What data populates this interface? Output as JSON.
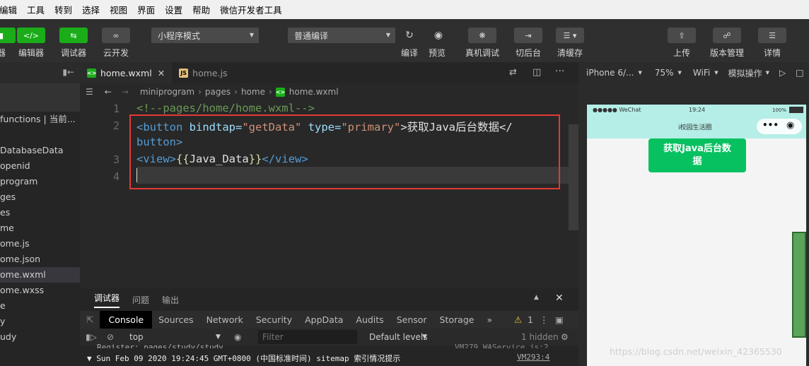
{
  "menu": [
    "编辑",
    "工具",
    "转到",
    "选择",
    "视图",
    "界面",
    "设置",
    "帮助",
    "微信开发者工具"
  ],
  "toolbar": {
    "left_partial": "器",
    "editor": "编辑器",
    "debugger": "调试器",
    "cloud": "云开发",
    "mode": "小程序模式",
    "compile_mode": "普通编译",
    "compile": "编译",
    "preview": "预览",
    "remote_debug": "真机调试",
    "background": "切后台",
    "clear_cache": "清缓存",
    "upload": "上传",
    "version": "版本管理",
    "details": "详情"
  },
  "sidebar": {
    "items": [
      "functions | 当前...",
      "",
      "DatabaseData",
      "openid",
      "program",
      "ges",
      "es",
      "me",
      "ome.js",
      "ome.json",
      "ome.wxml",
      "ome.wxss",
      "e",
      "y",
      "udy"
    ],
    "active_index": 10
  },
  "tabs": [
    {
      "name": "home.wxml",
      "icon": "wxml-file-icon",
      "active": true
    },
    {
      "name": "home.js",
      "icon": "js-file-icon",
      "active": false
    }
  ],
  "breadcrumb": [
    "miniprogram",
    "pages",
    "home",
    "home.wxml"
  ],
  "code": {
    "line_numbers": [
      "1",
      "2",
      "3",
      "4"
    ],
    "l1_comment": "<!--pages/home/home.wxml-->",
    "l2_open": "<",
    "l2_tag": "button",
    "l2_attr1": " bindtap=",
    "l2_val1": "\"getData\"",
    "l2_attr2": " type=",
    "l2_val2": "\"primary\"",
    "l2_text": ">获取Java后台数据</",
    "l2b_tag": "button",
    "l2b_close": ">",
    "l3_open": "<",
    "l3_tag": "view",
    "l3_close": ">",
    "l3_brace": "{{",
    "l3_var": "Java_Data",
    "l3_brace2": "}}",
    "l3_end": "</",
    "l3_tag2": "view",
    "l3_end2": ">"
  },
  "devtools": {
    "tabs": [
      "调试器",
      "问题",
      "输出"
    ],
    "panel_tabs": [
      "Console",
      "Sources",
      "Network",
      "Security",
      "AppData",
      "Audits",
      "Sensor",
      "Storage"
    ],
    "more": "»",
    "warnings": "1",
    "context": "top",
    "filter_placeholder": "Filter",
    "levels": "Default levels",
    "hidden": "1 hidden",
    "log1": "Register: pages/study/study",
    "log1_src": "VM279 WAService.js:2",
    "log2": "▼ Sun Feb 09 2020 19:24:45 GMT+0800 (中国标准时间) sitemap 索引情况提示",
    "log2_src": "VM293:4"
  },
  "simulator": {
    "device": "iPhone 6/...",
    "zoom": "75%",
    "network": "WiFi",
    "ops": "模拟操作",
    "status_left": "●●●●● WeChat",
    "status_time": "19:24",
    "status_battery": "100%",
    "nav_title": "i校园生活圈",
    "button_label": "获取Java后台数据"
  },
  "watermark": "https://blog.csdn.net/weixin_42365530"
}
